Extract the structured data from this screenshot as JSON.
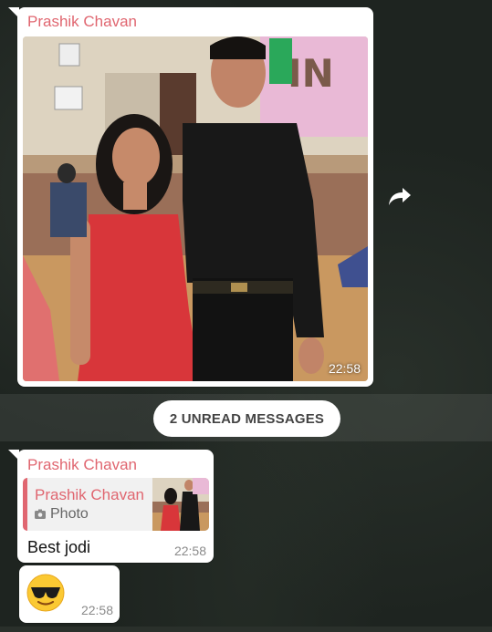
{
  "messages": [
    {
      "sender": "Prashik Chavan",
      "type": "photo",
      "time": "22:58"
    },
    {
      "sender": "Prashik Chavan",
      "quote": {
        "sender": "Prashik Chavan",
        "type_label": "Photo"
      },
      "text": "Best jodi",
      "time": "22:58"
    },
    {
      "emoji": "sunglasses-emoji",
      "time": "22:58"
    }
  ],
  "unread_banner": "2 UNREAD MESSAGES",
  "icons": {
    "forward": "forward-icon",
    "photo": "camera-icon"
  },
  "colors": {
    "sender": "#e06670",
    "bubble": "#ffffff",
    "time": "#8a8a8a"
  }
}
